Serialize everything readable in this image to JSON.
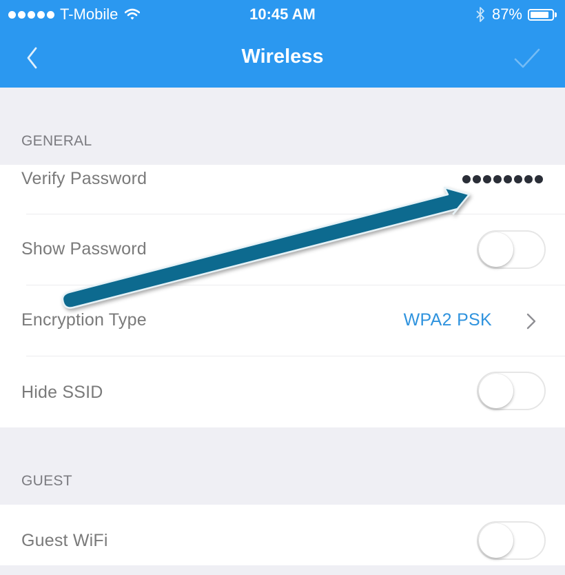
{
  "status_bar": {
    "carrier": "T-Mobile",
    "time": "10:45 AM",
    "battery_percent": "87%",
    "battery_level": 0.87
  },
  "nav": {
    "title": "Wireless",
    "back_icon": "chevron-left-icon",
    "confirm_icon": "checkmark-icon"
  },
  "sections": {
    "general": {
      "header": "GENERAL",
      "verify_password": {
        "label": "Verify Password",
        "masked_value": "••••••••"
      },
      "show_password": {
        "label": "Show Password",
        "enabled": false
      },
      "encryption_type": {
        "label": "Encryption Type",
        "value": "WPA2 PSK"
      },
      "hide_ssid": {
        "label": "Hide SSID",
        "enabled": false
      }
    },
    "guest": {
      "header": "GUEST",
      "guest_wifi": {
        "label": "Guest WiFi",
        "enabled": false
      }
    }
  },
  "colors": {
    "header_blue": "#2b98f0",
    "accent_blue": "#2f93de",
    "annotation_arrow": "#0f6a8f"
  }
}
